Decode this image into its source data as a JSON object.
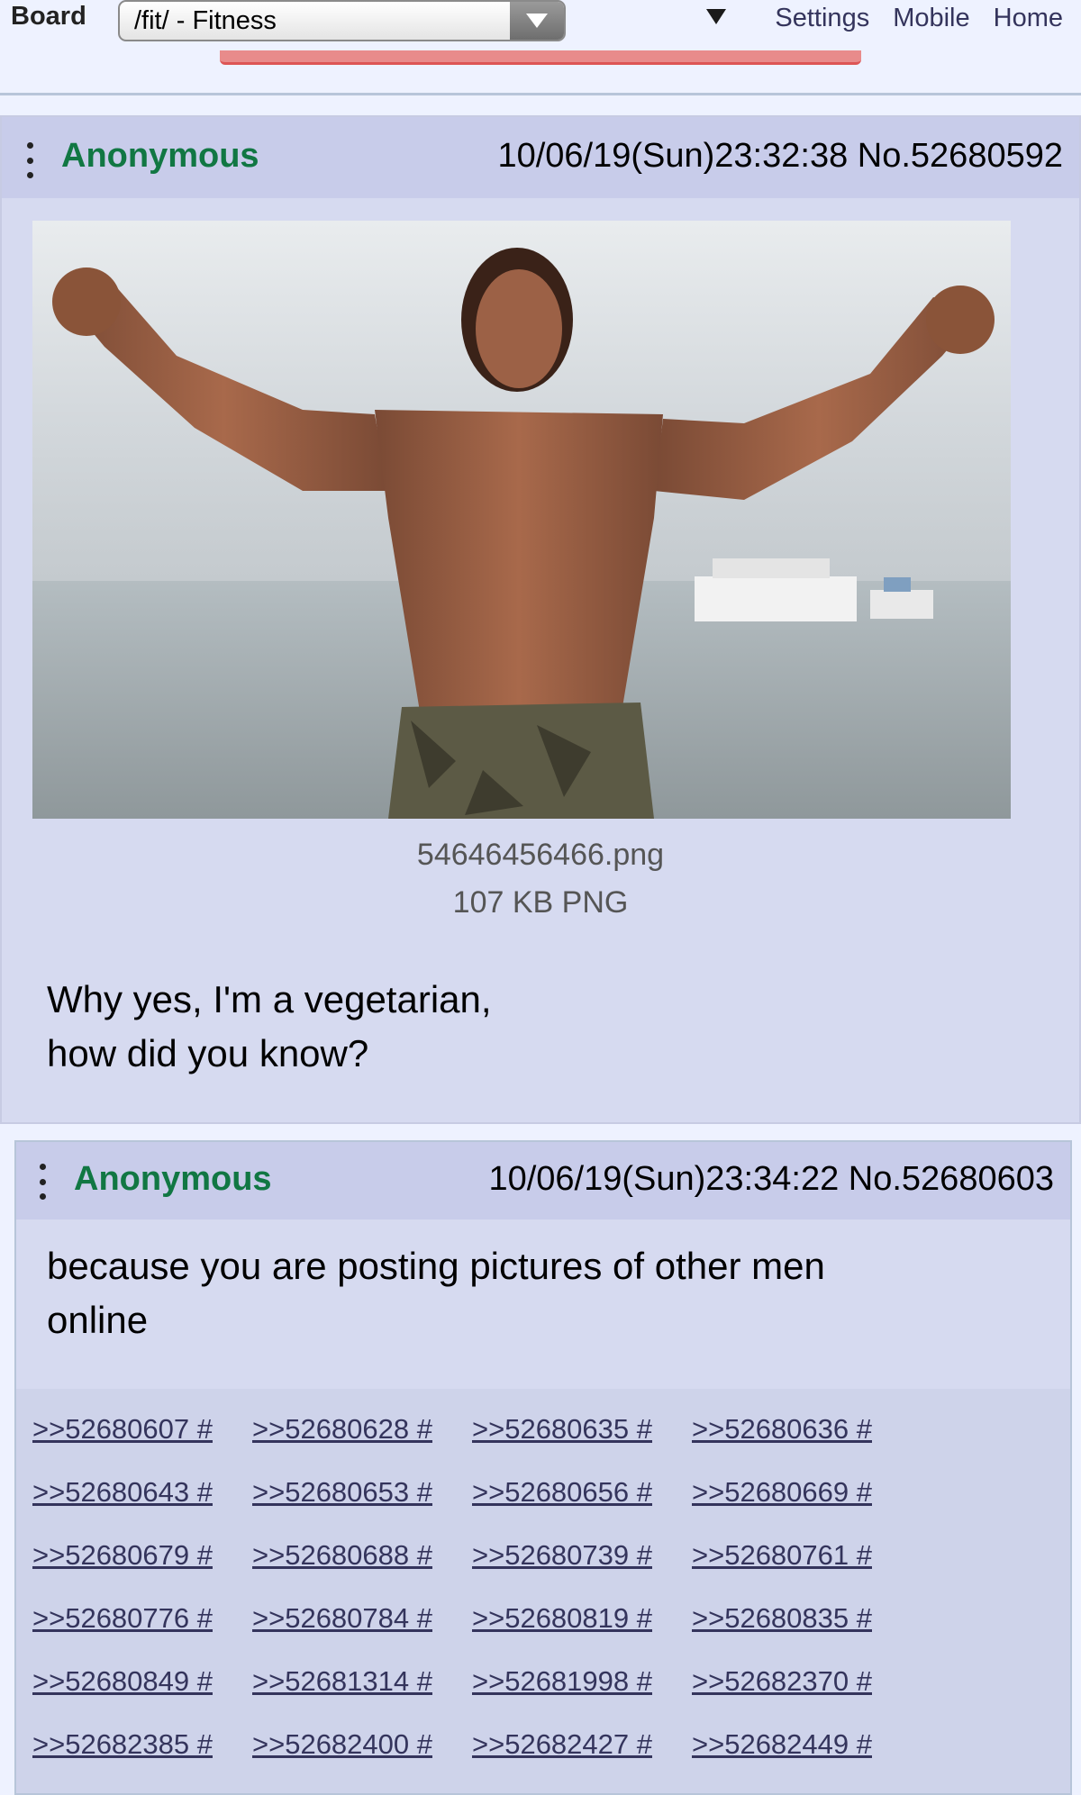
{
  "topbar": {
    "board_label": "Board",
    "board_select_value": "/fit/ - Fitness",
    "links": [
      "Settings",
      "Mobile",
      "Home"
    ]
  },
  "op": {
    "name": "Anonymous",
    "datetime": "10/06/19(Sun)23:32:38",
    "post_no": "No.52680592",
    "file_name": "54646456466.png",
    "file_size": "107 KB PNG",
    "comment": "Why yes, I'm a vegetarian,\nhow did you know?"
  },
  "reply": {
    "name": "Anonymous",
    "datetime": "10/06/19(Sun)23:34:22",
    "post_no": "No.52680603",
    "comment": "because you are posting pictures of other men\nonline",
    "backlinks": [
      [
        ">>52680607 #",
        ">>52680628 #",
        ">>52680635 #",
        ">>52680636 #"
      ],
      [
        ">>52680643 #",
        ">>52680653 #",
        ">>52680656 #",
        ">>52680669 #"
      ],
      [
        ">>52680679 #",
        ">>52680688 #",
        ">>52680739 #",
        ">>52680761 #"
      ],
      [
        ">>52680776 #",
        ">>52680784 #",
        ">>52680819 #",
        ">>52680835 #"
      ],
      [
        ">>52680849 #",
        ">>52681314 #",
        ">>52681998 #",
        ">>52682370 #"
      ],
      [
        ">>52682385 #",
        ">>52682400 #",
        ">>52682427 #",
        ">>52682449 #"
      ]
    ]
  },
  "colors": {
    "name_green": "#117743",
    "link_blue": "#34345c",
    "post_bg": "#d6daf0",
    "page_bg": "#eef2ff"
  }
}
